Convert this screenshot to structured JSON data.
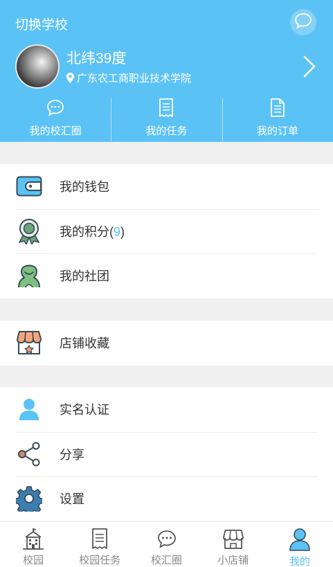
{
  "header": {
    "switch_school": "切换学校",
    "user_name": "北纬39度",
    "school_name": "广东农工商职业技术学院"
  },
  "quick_links": [
    {
      "label": "我的校汇圈",
      "icon": "chat-bubble-icon"
    },
    {
      "label": "我的任务",
      "icon": "receipt-icon"
    },
    {
      "label": "我的订单",
      "icon": "document-icon"
    }
  ],
  "menu_group_1": [
    {
      "label": "我的钱包",
      "icon": "wallet-icon"
    },
    {
      "label": "我的积分",
      "count_open": "(",
      "count": "9",
      "count_close": ")",
      "icon": "medal-icon"
    },
    {
      "label": "我的社团",
      "icon": "club-icon"
    }
  ],
  "menu_group_2": [
    {
      "label": "店铺收藏",
      "icon": "store-favorite-icon"
    }
  ],
  "menu_group_3": [
    {
      "label": "实名认证",
      "icon": "user-verify-icon"
    },
    {
      "label": "分享",
      "icon": "share-icon"
    },
    {
      "label": "设置",
      "icon": "gear-icon"
    }
  ],
  "tabbar": [
    {
      "label": "校园",
      "icon": "campus-icon"
    },
    {
      "label": "校园任务",
      "icon": "receipt-icon"
    },
    {
      "label": "校汇圈",
      "icon": "chat-bubble-icon"
    },
    {
      "label": "小店铺",
      "icon": "store-icon"
    },
    {
      "label": "我的",
      "icon": "user-icon",
      "active": true
    }
  ],
  "colors": {
    "accent": "#5bc2f5",
    "wallet": "#5bc2f5",
    "medal": "#6aa57c",
    "club": "#7dc07f",
    "store": "#f4a57c",
    "share": "#c98a6a",
    "gear": "#3a7fb0",
    "background": "#f0f0f0"
  }
}
